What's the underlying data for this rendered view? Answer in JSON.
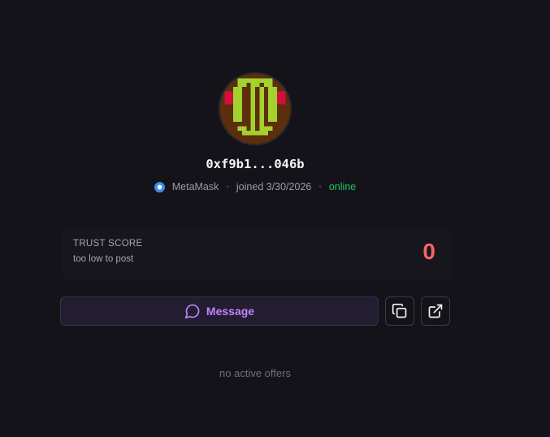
{
  "profile": {
    "address": "0xf9b1...046b",
    "wallet": "MetaMask",
    "joined": "joined 3/30/2026",
    "status": "online",
    "avatar_icon": "pixel-avatar-icon",
    "colors": {
      "avatar_bg": "#5c2e0c",
      "avatar_green": "#a3d12e",
      "avatar_red": "#d0103a",
      "online": "#22c55e"
    }
  },
  "trust": {
    "title": "TRUST SCORE",
    "subtitle": "too low to post",
    "score": "0",
    "color": "#f56565"
  },
  "actions": {
    "message_label": "Message",
    "message_icon": "message-circle-icon",
    "copy_icon": "copy-icon",
    "open_icon": "external-link-icon"
  },
  "offers": {
    "empty_text": "no active offers"
  }
}
